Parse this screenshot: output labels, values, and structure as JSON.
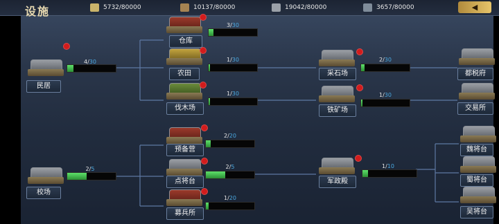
{
  "title": "设施",
  "resources": [
    {
      "icon": "grain-icon",
      "value": "5732/80000"
    },
    {
      "icon": "wood-icon",
      "value": "10137/80000"
    },
    {
      "icon": "stone-icon",
      "value": "19042/80000"
    },
    {
      "icon": "iron-icon",
      "value": "3657/80000"
    }
  ],
  "back_label": "",
  "buildings": {
    "minju": {
      "name": "民居",
      "level": "4",
      "max": "30",
      "progress": 0.13
    },
    "cangku": {
      "name": "仓库",
      "level": "3",
      "max": "30",
      "progress": 0.1
    },
    "nongtian": {
      "name": "农田",
      "level": "1",
      "max": "30",
      "progress": 0.03
    },
    "famu": {
      "name": "伐木场",
      "level": "1",
      "max": "30",
      "progress": 0.03
    },
    "caishi": {
      "name": "采石场",
      "level": "2",
      "max": "30",
      "progress": 0.07
    },
    "tiekuang": {
      "name": "铁矿场",
      "level": "1",
      "max": "30",
      "progress": 0.03
    },
    "dushui": {
      "name": "都税府"
    },
    "jiaoyi": {
      "name": "交易所"
    },
    "yubei": {
      "name": "预备营",
      "level": "2",
      "max": "20",
      "progress": 0.1
    },
    "dianjiang": {
      "name": "点将台",
      "level": "2",
      "max": "5",
      "progress": 0.4
    },
    "mubing": {
      "name": "募兵所",
      "level": "1",
      "max": "20",
      "progress": 0.05
    },
    "jiaochang": {
      "name": "校场",
      "level": "2",
      "max": "5",
      "progress": 0.4
    },
    "junzheng": {
      "name": "军政殿",
      "level": "1",
      "max": "10",
      "progress": 0.1
    },
    "wei": {
      "name": "魏将台"
    },
    "shu": {
      "name": "蜀将台"
    },
    "wu": {
      "name": "吴将台"
    }
  },
  "colors": {
    "accent": "#e7c46a",
    "progress": "#3fbf4b",
    "max_level": "#4aa8e0",
    "badge": "#d21c1c"
  }
}
